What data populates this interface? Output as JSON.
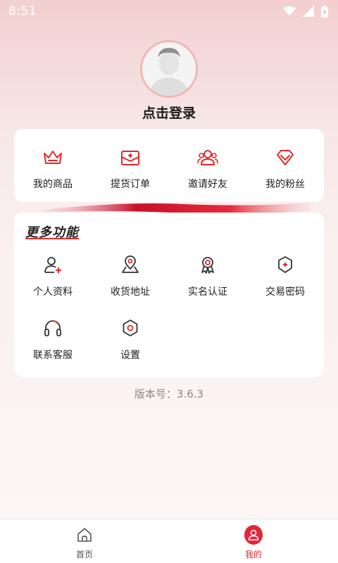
{
  "status_bar": {
    "time": "8:51"
  },
  "profile": {
    "login_text": "点击登录"
  },
  "quick_actions": [
    {
      "label": "我的商品",
      "icon": "crown-icon"
    },
    {
      "label": "提货订单",
      "icon": "order-envelope-icon"
    },
    {
      "label": "邀请好友",
      "icon": "invite-friends-icon"
    },
    {
      "label": "我的粉丝",
      "icon": "diamond-icon"
    }
  ],
  "more": {
    "title": "更多功能",
    "items": [
      {
        "label": "个人资料",
        "icon": "user-add-icon"
      },
      {
        "label": "收货地址",
        "icon": "location-icon"
      },
      {
        "label": "实名认证",
        "icon": "certificate-icon"
      },
      {
        "label": "交易密码",
        "icon": "shield-icon"
      },
      {
        "label": "联系客服",
        "icon": "headset-icon"
      },
      {
        "label": "设置",
        "icon": "settings-icon"
      }
    ]
  },
  "version": "版本号：3.6.3",
  "tabbar": {
    "home_label": "首页",
    "mine_label": "我的"
  },
  "colors": {
    "accent": "#e02a2a",
    "active_tab": "#e8243a"
  }
}
